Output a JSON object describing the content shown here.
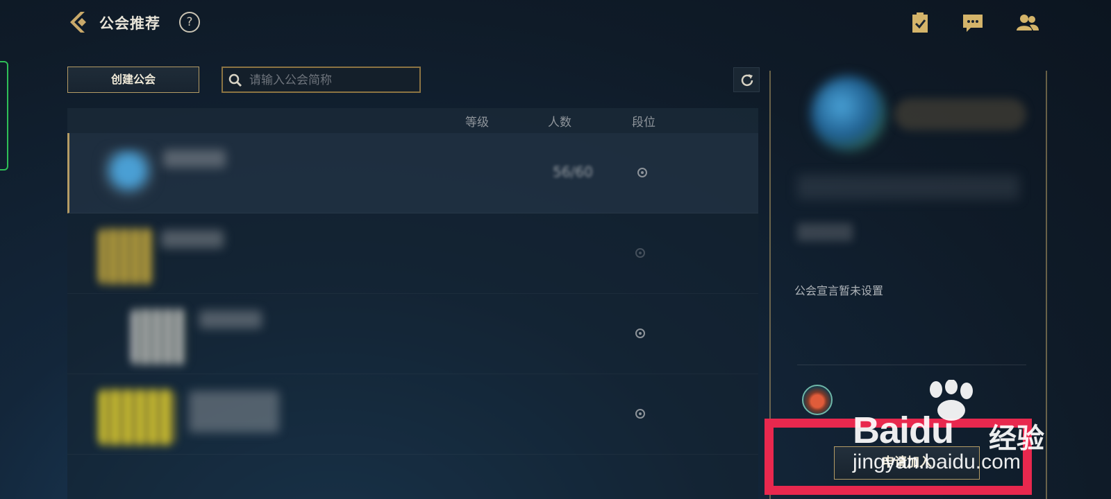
{
  "header": {
    "title": "公会推荐",
    "help_label": "?",
    "icons": [
      "tasks-icon",
      "chat-icon",
      "friends-icon"
    ]
  },
  "actions": {
    "create_label": "创建公会",
    "search_placeholder": "请输入公会简称"
  },
  "table": {
    "columns": [
      "等级",
      "人数",
      "段位"
    ],
    "rows": [
      {
        "members": "56/60"
      },
      {
        "members": ""
      },
      {
        "members": ""
      },
      {
        "members": ""
      }
    ]
  },
  "detail": {
    "declaration": "公会宣言暂未设置",
    "apply_label": "申请加入"
  },
  "watermark": {
    "brand": "Baidu",
    "brand_cn": "经验",
    "url": "jingyan.baidu.com"
  },
  "colors": {
    "gold": "#b59c65",
    "highlight": "#e8284e",
    "green_tab": "#2fbf57"
  }
}
